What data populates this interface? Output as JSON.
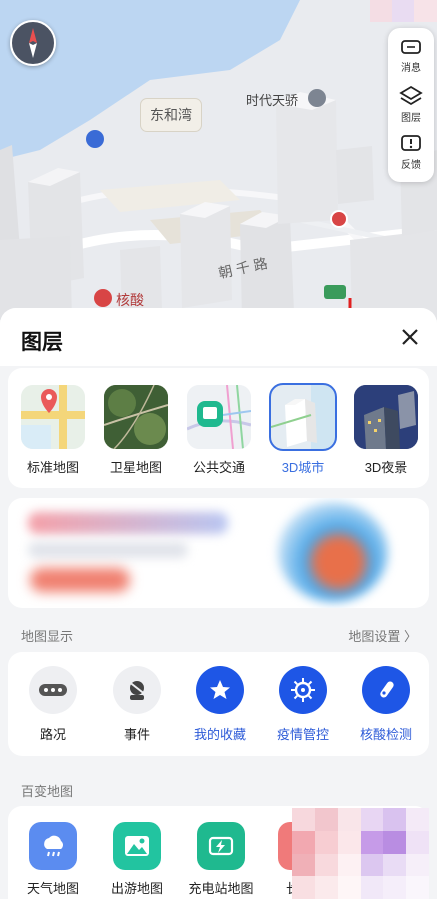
{
  "map": {
    "place_label": "东和湾",
    "tower_label": "时代天骄",
    "road_label": "朝 千 路",
    "poi_label": "核酸",
    "toolbar": [
      {
        "label": "消息",
        "icon": "message-icon"
      },
      {
        "label": "图层",
        "icon": "layers-icon"
      },
      {
        "label": "反馈",
        "icon": "feedback-icon"
      }
    ]
  },
  "sheet": {
    "title": "图层",
    "layer_types": [
      {
        "label": "标准地图",
        "selected": false
      },
      {
        "label": "卫星地图",
        "selected": false
      },
      {
        "label": "公共交通",
        "selected": false
      },
      {
        "label": "3D城市",
        "selected": true
      },
      {
        "label": "3D夜景",
        "selected": false
      }
    ],
    "map_display": {
      "section_label": "地图显示",
      "settings_link": "地图设置 〉",
      "items": [
        {
          "label": "路况",
          "icon": "traffic-icon",
          "active": false
        },
        {
          "label": "事件",
          "icon": "event-icon",
          "active": false
        },
        {
          "label": "我的收藏",
          "icon": "star-icon",
          "active": true
        },
        {
          "label": "疫情管控",
          "icon": "virus-icon",
          "active": true
        },
        {
          "label": "核酸检测",
          "icon": "test-tube-icon",
          "active": true
        }
      ]
    },
    "variety_maps": {
      "section_label": "百变地图",
      "items": [
        {
          "label": "天气地图",
          "icon": "weather-icon",
          "color": "#5b8cf0"
        },
        {
          "label": "出游地图",
          "icon": "travel-icon",
          "color": "#22c4a0"
        },
        {
          "label": "充电站地图",
          "icon": "charging-icon",
          "color": "#1fb98f"
        },
        {
          "label": "长",
          "icon": "partial-icon",
          "color": "#f07a7a"
        }
      ]
    }
  },
  "colors": {
    "accent": "#3a6fe0",
    "active_circle": "#1e56e6",
    "annotation_arrow": "#e02020"
  }
}
